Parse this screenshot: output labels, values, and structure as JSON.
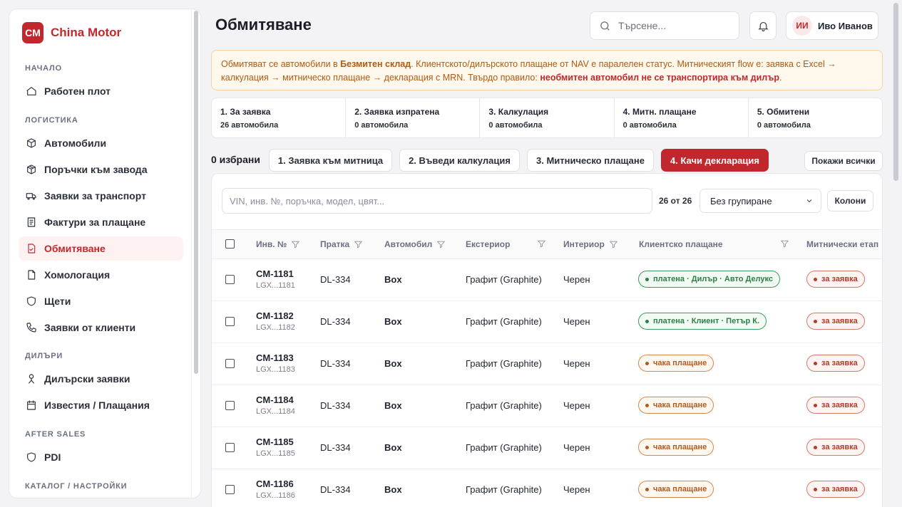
{
  "brand": {
    "badge": "CM",
    "name": "China Motor",
    "accent": "#c0282d"
  },
  "sidebar": {
    "sections": [
      {
        "label": "НАЧАЛО"
      },
      {
        "label": "ЛОГИСТИКА"
      },
      {
        "label": "ДИЛЪРИ"
      },
      {
        "label": "AFTER SALES"
      },
      {
        "label": "КАТАЛОГ / НАСТРОЙКИ"
      }
    ],
    "items": [
      {
        "label": "Работен плот",
        "icon": "home-icon"
      },
      {
        "label": "Автомобили",
        "icon": "box-icon"
      },
      {
        "label": "Поръчки към завода",
        "icon": "package-icon"
      },
      {
        "label": "Заявки за транспорт",
        "icon": "truck-icon"
      },
      {
        "label": "Фактури за плащане",
        "icon": "receipt-icon"
      },
      {
        "label": "Обмитяване",
        "icon": "file-check-icon",
        "active": true
      },
      {
        "label": "Хомологация",
        "icon": "file-icon"
      },
      {
        "label": "Щети",
        "icon": "shield-icon"
      },
      {
        "label": "Заявки от клиенти",
        "icon": "phone-icon"
      },
      {
        "label": "Дилърски заявки",
        "icon": "person-icon"
      },
      {
        "label": "Известия / Плащания",
        "icon": "calendar-icon"
      },
      {
        "label": "PDI",
        "icon": "shield-icon"
      }
    ]
  },
  "header": {
    "title": "Обмитяване",
    "search_placeholder": "Търсене...",
    "user": {
      "initials": "ИИ",
      "name": "Иво Иванов"
    }
  },
  "notice": {
    "p1": "Обмитяват се автомобили в ",
    "b1": "Безмитен склад",
    "p2": ". Клиентското/дилърското плащане от NAV е паралелен статус. Митническият flow е: заявка с Excel → калкулация → митническо плащане → декларация с MRN. Твърдо правило: ",
    "b2": "необмитен автомобил не се транспортира към дилър",
    "p3": "."
  },
  "steps": [
    {
      "title": "1. За заявка",
      "count": "26 автомобила"
    },
    {
      "title": "2. Заявка изпратена",
      "count": "0 автомобила"
    },
    {
      "title": "3. Калкулация",
      "count": "0 автомобила"
    },
    {
      "title": "4. Митн. плащане",
      "count": "0 автомобила"
    },
    {
      "title": "5. Обмитени",
      "count": "0 автомобила"
    }
  ],
  "actions": {
    "selected": "0 избрани",
    "b1": "1. Заявка към митница",
    "b2": "2. Въведи калкулация",
    "b3": "3. Митническо плащане",
    "b4": "4. Качи декларация",
    "show_all": "Покажи всички"
  },
  "table": {
    "filter_placeholder": "VIN, инв. №, поръчка, модел, цвят...",
    "count": "26 от 26",
    "grouping": "Без групиране",
    "columns_btn": "Колони",
    "headers": {
      "inv": "Инв. №",
      "shipment": "Пратка",
      "car": "Автомобил",
      "exterior": "Екстериор",
      "interior": "Интериор",
      "client_pay": "Клиентско плащане",
      "customs": "Митнически етап"
    },
    "rows": [
      {
        "inv": "CM-1181",
        "vin": "LGX...1181",
        "shipment": "DL-334",
        "car": "Box",
        "exterior": "Графит (Graphite)",
        "interior": "Черен",
        "payment": "платена · Дилър · Авто Делукс",
        "payment_status": "green",
        "stage": "за заявка"
      },
      {
        "inv": "CM-1182",
        "vin": "LGX...1182",
        "shipment": "DL-334",
        "car": "Box",
        "exterior": "Графит (Graphite)",
        "interior": "Черен",
        "payment": "платена · Клиент · Петър К.",
        "payment_status": "green",
        "stage": "за заявка"
      },
      {
        "inv": "CM-1183",
        "vin": "LGX...1183",
        "shipment": "DL-334",
        "car": "Box",
        "exterior": "Графит (Graphite)",
        "interior": "Черен",
        "payment": "чака плащане",
        "payment_status": "orange",
        "stage": "за заявка"
      },
      {
        "inv": "CM-1184",
        "vin": "LGX...1184",
        "shipment": "DL-334",
        "car": "Box",
        "exterior": "Графит (Graphite)",
        "interior": "Черен",
        "payment": "чака плащане",
        "payment_status": "orange",
        "stage": "за заявка"
      },
      {
        "inv": "CM-1185",
        "vin": "LGX...1185",
        "shipment": "DL-334",
        "car": "Box",
        "exterior": "Графит (Graphite)",
        "interior": "Черен",
        "payment": "чака плащане",
        "payment_status": "orange",
        "stage": "за заявка"
      },
      {
        "inv": "CM-1186",
        "vin": "LGX...1186",
        "shipment": "DL-334",
        "car": "Box",
        "exterior": "Графит (Graphite)",
        "interior": "Черен",
        "payment": "чака плащане",
        "payment_status": "orange",
        "stage": "за заявка"
      }
    ]
  }
}
